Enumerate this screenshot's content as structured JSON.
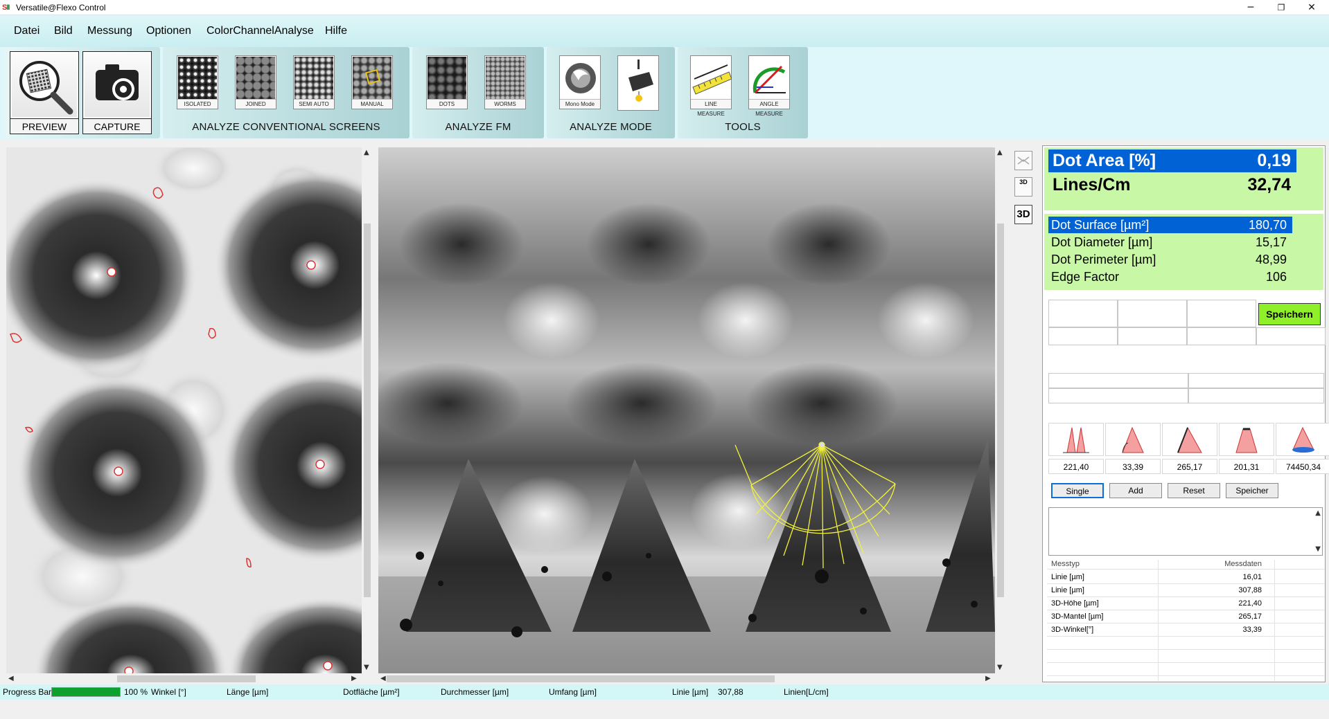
{
  "window": {
    "title": "Versatile@Flexo Control",
    "minimize": "─",
    "maximize": "❐",
    "close": "✕",
    "logo_a": "S",
    "logo_b": "II"
  },
  "menu": [
    "Datei",
    "Bild",
    "Messung",
    "Optionen",
    "ColorChannelAnalyse",
    "Hilfe"
  ],
  "toolbar": {
    "preview_label": "PREVIEW",
    "capture_label": "CAPTURE",
    "conventional": {
      "label": "ANALYZE CONVENTIONAL SCREENS",
      "buttons": [
        "ISOLATED",
        "JOINED",
        "SEMI AUTO",
        "MANUAL"
      ]
    },
    "fm": {
      "label": "ANALYZE FM",
      "buttons": [
        "DOTS",
        "WORMS"
      ]
    },
    "mode": {
      "label": "ANALYZE MODE",
      "buttons": [
        "Mono Mode",
        ""
      ]
    },
    "tools": {
      "label": "TOOLS",
      "buttons": [
        "LINE MEASURE",
        "ANGLE MEASURE"
      ]
    }
  },
  "sidetools": {
    "view_3d": "3D",
    "view_3dlabel": "3D"
  },
  "panel": {
    "dot_area": {
      "label": "Dot Area [%]",
      "value": "0,19"
    },
    "lines_cm": {
      "label": "Lines/Cm",
      "value": "32,74"
    },
    "metrics": [
      {
        "label": "Dot Surface [µm²]",
        "value": "180,70"
      },
      {
        "label": "Dot Diameter [µm]",
        "value": "15,17"
      },
      {
        "label": "Dot Perimeter [µm]",
        "value": "48,99"
      },
      {
        "label": "Edge Factor",
        "value": "106"
      }
    ],
    "save_label": "Speichern",
    "shape_values": [
      "221,40",
      "33,39",
      "265,17",
      "201,31",
      "74450,34"
    ],
    "controls": [
      "Single",
      "Add",
      "Reset",
      "Speicher"
    ],
    "table": {
      "headers": [
        "Messtyp",
        "Messdaten"
      ],
      "rows": [
        [
          "Linie [µm]",
          "16,01"
        ],
        [
          "Linie [µm]",
          "307,88"
        ],
        [
          "3D-Höhe [µm]",
          "221,40"
        ],
        [
          "3D-Mantel [µm]",
          "265,17"
        ],
        [
          "3D-Winkel[°]",
          "33,39"
        ]
      ]
    }
  },
  "status": {
    "progress_label": "Progress Bar",
    "progress_value": 100,
    "progress_text": "100 %",
    "winkel": "Winkel [°]",
    "laenge": "Länge [µm]",
    "dotflaeche": "Dotfläche [µm²]",
    "durchmesser": "Durchmesser [µm]",
    "umfang": "Umfang [µm]",
    "linie": "Linie [µm]",
    "linie_value": "307,88",
    "linien": "Linien[L/cm]"
  },
  "colors": {
    "selection": "#0062d4",
    "panel_green": "#c8f7a6",
    "save_green": "#8ff02a",
    "progress": "#0ca02c",
    "cone": "#f2f23a"
  }
}
